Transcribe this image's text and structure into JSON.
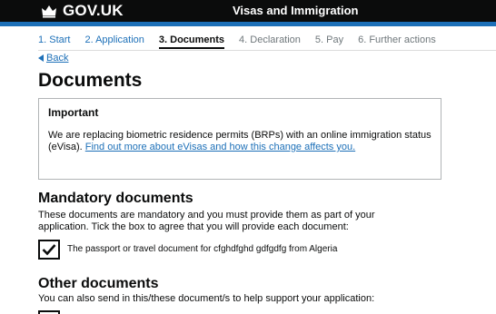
{
  "header": {
    "logo_text": "GOV.UK",
    "service_name": "Visas and Immigration"
  },
  "steps": [
    {
      "label": "1. Start",
      "state": "done"
    },
    {
      "label": "2. Application",
      "state": "done"
    },
    {
      "label": "3. Documents",
      "state": "current"
    },
    {
      "label": "4. Declaration",
      "state": "future"
    },
    {
      "label": "5. Pay",
      "state": "future"
    },
    {
      "label": "6. Further actions",
      "state": "future"
    }
  ],
  "back_link": "Back",
  "page_title": "Documents",
  "important": {
    "title": "Important",
    "body_text": "We are replacing biometric residence permits (BRPs) with an online immigration status (eVisa). ",
    "link_text": "Find out more about eVisas and how this change affects you."
  },
  "mandatory": {
    "heading": "Mandatory documents",
    "description": "These documents are mandatory and you must provide them as part of your application. Tick the box to agree that you will provide each document:",
    "items": [
      {
        "label": "The passport or travel document for cfghdfghd gdfgdfg from Algeria",
        "checked": true
      }
    ]
  },
  "other": {
    "heading": "Other documents",
    "description": "You can also send in this/these document/s to help support your application:"
  },
  "colors": {
    "header_bg": "#0b0c0c",
    "accent": "#1d70b8"
  }
}
